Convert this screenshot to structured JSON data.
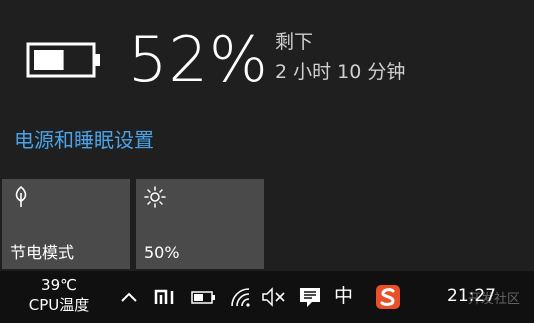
{
  "battery": {
    "level_percent": 52,
    "percent_text": "52%",
    "remaining_label": "剩下",
    "remaining_time": "2 小时 10 分钟"
  },
  "settings_link": "电源和睡眠设置",
  "tiles": [
    {
      "label": "节电模式",
      "icon": "leaf-icon"
    },
    {
      "label": "50%",
      "icon": "brightness-icon"
    }
  ],
  "taskbar": {
    "temperature": "39℃",
    "temperature_label": "CPU温度",
    "input_mode": "中",
    "clock": "21:27",
    "watermark": "开发社区",
    "tray_icons": [
      "chevron-up-icon",
      "mi-icon",
      "battery-icon",
      "wifi-icon",
      "volume-muted-icon",
      "notification-icon",
      "ime-icon",
      "sogou-icon"
    ]
  },
  "colors": {
    "background": "#1f1f1f",
    "tile": "#4a4a4a",
    "link": "#4aa3e8",
    "taskbar": "#101010"
  }
}
